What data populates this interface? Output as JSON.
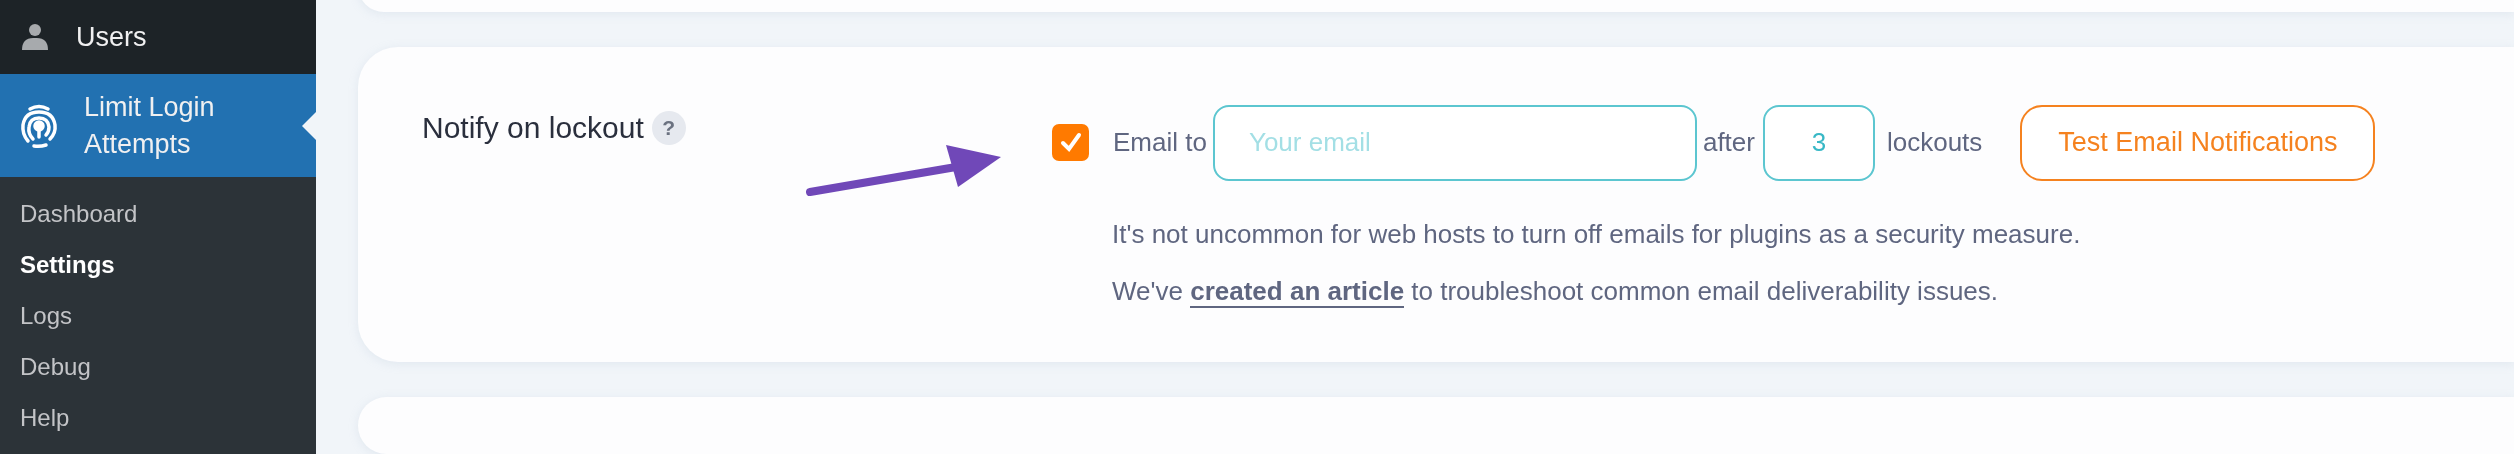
{
  "sidebar": {
    "items": [
      {
        "kind": "menu",
        "label": "Users",
        "selected": false
      },
      {
        "kind": "menu",
        "label": "Limit Login Attempts",
        "selected": true
      },
      {
        "kind": "submenu",
        "label": "Dashboard",
        "selected": false
      },
      {
        "kind": "submenu",
        "label": "Settings",
        "selected": true
      },
      {
        "kind": "submenu",
        "label": "Logs",
        "selected": false
      },
      {
        "kind": "submenu",
        "label": "Debug",
        "selected": false
      },
      {
        "kind": "submenu",
        "label": "Help",
        "selected": false
      }
    ]
  },
  "setting": {
    "label": "Notify on lockout",
    "help": "?",
    "checkbox": {
      "checked": true,
      "label": "Email to"
    },
    "email": {
      "placeholder": "Your email"
    },
    "after": "after",
    "count": "3",
    "unit": "lockouts",
    "button": "Test Email Notifications",
    "note": [
      "It's not uncommon for web hosts to turn off emails for plugins as a security measure."
    ],
    "note2": {
      "before": "We've",
      "link": "created an article",
      "after": "to troubleshoot common email deliverability issues."
    }
  }
}
